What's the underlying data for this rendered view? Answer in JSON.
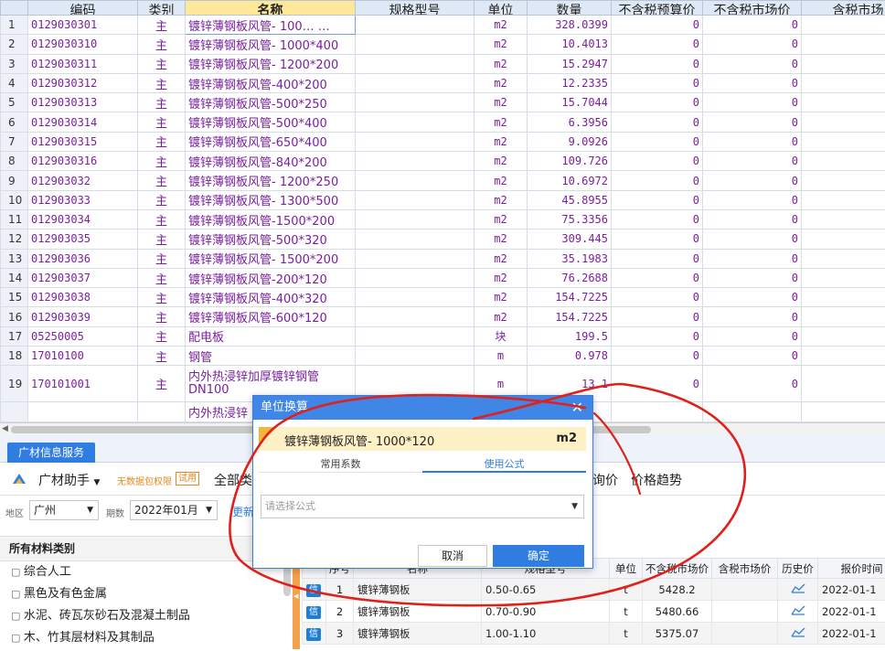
{
  "grid": {
    "headers": [
      "编码",
      "类别",
      "名称",
      "规格型号",
      "单位",
      "数量",
      "不含税预算价",
      "不含税市场价",
      "含税市场"
    ],
    "rows": [
      {
        "n": "1",
        "code": "0129030301",
        "cat": "主",
        "name": "镀锌薄钢板风管- 100…  …",
        "unit": "m2",
        "qty": "328.0399",
        "p1": "0",
        "p2": "0"
      },
      {
        "n": "2",
        "code": "0129030310",
        "cat": "主",
        "name": "镀锌薄钢板风管- 1000*400",
        "unit": "m2",
        "qty": "10.4013",
        "p1": "0",
        "p2": "0"
      },
      {
        "n": "3",
        "code": "0129030311",
        "cat": "主",
        "name": "镀锌薄钢板风管- 1200*200",
        "unit": "m2",
        "qty": "15.2947",
        "p1": "0",
        "p2": "0"
      },
      {
        "n": "4",
        "code": "0129030312",
        "cat": "主",
        "name": "镀锌薄钢板风管-400*200",
        "unit": "m2",
        "qty": "12.2335",
        "p1": "0",
        "p2": "0"
      },
      {
        "n": "5",
        "code": "0129030313",
        "cat": "主",
        "name": "镀锌薄钢板风管-500*250",
        "unit": "m2",
        "qty": "15.7044",
        "p1": "0",
        "p2": "0"
      },
      {
        "n": "6",
        "code": "0129030314",
        "cat": "主",
        "name": "镀锌薄钢板风管-500*400",
        "unit": "m2",
        "qty": "6.3956",
        "p1": "0",
        "p2": "0"
      },
      {
        "n": "7",
        "code": "0129030315",
        "cat": "主",
        "name": "镀锌薄钢板风管-650*400",
        "unit": "m2",
        "qty": "9.0926",
        "p1": "0",
        "p2": "0"
      },
      {
        "n": "8",
        "code": "0129030316",
        "cat": "主",
        "name": "镀锌薄钢板风管-840*200",
        "unit": "m2",
        "qty": "109.726",
        "p1": "0",
        "p2": "0"
      },
      {
        "n": "9",
        "code": "012903032",
        "cat": "主",
        "name": "镀锌薄钢板风管- 1200*250",
        "unit": "m2",
        "qty": "10.6972",
        "p1": "0",
        "p2": "0"
      },
      {
        "n": "10",
        "code": "012903033",
        "cat": "主",
        "name": "镀锌薄钢板风管- 1300*500",
        "unit": "m2",
        "qty": "45.8955",
        "p1": "0",
        "p2": "0"
      },
      {
        "n": "11",
        "code": "012903034",
        "cat": "主",
        "name": "镀锌薄钢板风管-1500*200",
        "unit": "m2",
        "qty": "75.3356",
        "p1": "0",
        "p2": "0"
      },
      {
        "n": "12",
        "code": "012903035",
        "cat": "主",
        "name": "镀锌薄钢板风管-500*320",
        "unit": "m2",
        "qty": "309.445",
        "p1": "0",
        "p2": "0"
      },
      {
        "n": "13",
        "code": "012903036",
        "cat": "主",
        "name": "镀锌薄钢板风管- 1500*200",
        "unit": "m2",
        "qty": "35.1983",
        "p1": "0",
        "p2": "0"
      },
      {
        "n": "14",
        "code": "012903037",
        "cat": "主",
        "name": "镀锌薄钢板风管-200*120",
        "unit": "m2",
        "qty": "76.2688",
        "p1": "0",
        "p2": "0"
      },
      {
        "n": "15",
        "code": "012903038",
        "cat": "主",
        "name": "镀锌薄钢板风管-400*320",
        "unit": "m2",
        "qty": "154.7225",
        "p1": "0",
        "p2": "0"
      },
      {
        "n": "16",
        "code": "012903039",
        "cat": "主",
        "name": "镀锌薄钢板风管-600*120",
        "unit": "m2",
        "qty": "154.7225",
        "p1": "0",
        "p2": "0"
      },
      {
        "n": "17",
        "code": "05250005",
        "cat": "主",
        "name": "配电板",
        "unit": "块",
        "qty": "199.5",
        "p1": "0",
        "p2": "0"
      },
      {
        "n": "18",
        "code": "17010100",
        "cat": "主",
        "name": "钢管",
        "unit": "m",
        "qty": "0.978",
        "p1": "0",
        "p2": "0"
      },
      {
        "n": "19",
        "code": "170101001",
        "cat": "主",
        "name": "内外热浸锌加厚镀锌钢管 DN100",
        "unit": "m",
        "qty": "13.1",
        "p1": "0",
        "p2": "0"
      },
      {
        "n": "",
        "code": "",
        "cat": "",
        "name": "内外热浸锌",
        "unit": "",
        "qty": "",
        "p1": "",
        "p2": ""
      }
    ]
  },
  "panel": {
    "tab": "广材信息服务",
    "helper": "广材助手",
    "no_priv": "无数据包权限",
    "trial": "试用",
    "all_types": "全部类",
    "inquiry": "询价",
    "trend": "价格趋势",
    "region_label": "地区",
    "region": "广州",
    "period_label": "期数",
    "period": "2022年01月",
    "update": "更新"
  },
  "categories": {
    "header": "所有材料类别",
    "items": [
      "综合人工",
      "黑色及有色金属",
      "水泥、砖瓦灰砂石及混凝土制品",
      "木、竹其层材料及其制品"
    ]
  },
  "materials": {
    "headers": [
      "",
      "序号",
      "名称",
      "规格型号",
      "单位",
      "不含税市场价",
      "含税市场价",
      "历史价",
      "报价时间"
    ],
    "rows": [
      {
        "badge": "信",
        "n": "1",
        "name": "镀锌薄钢板",
        "spec": "0.50-0.65",
        "unit": "t",
        "price": "5428.2",
        "tax": "",
        "date": "2022-01-1"
      },
      {
        "badge": "信",
        "n": "2",
        "name": "镀锌薄钢板",
        "spec": "0.70-0.90",
        "unit": "t",
        "price": "5480.66",
        "tax": "",
        "date": "2022-01-1"
      },
      {
        "badge": "信",
        "n": "3",
        "name": "镀锌薄钢板",
        "spec": "1.00-1.10",
        "unit": "t",
        "price": "5375.07",
        "tax": "",
        "date": "2022-01-1"
      }
    ]
  },
  "dialog": {
    "title": "单位换算",
    "item_name": "镀锌薄钢板风管- 1000*120",
    "item_unit": "m2",
    "tab_common": "常用系数",
    "tab_formula": "使用公式",
    "formula_placeholder": "请选择公式",
    "cancel": "取消",
    "ok": "确定"
  },
  "colors": {
    "accent": "#2f7de1",
    "text_purple": "#7a1fa0",
    "annotation": "#e0201a"
  }
}
